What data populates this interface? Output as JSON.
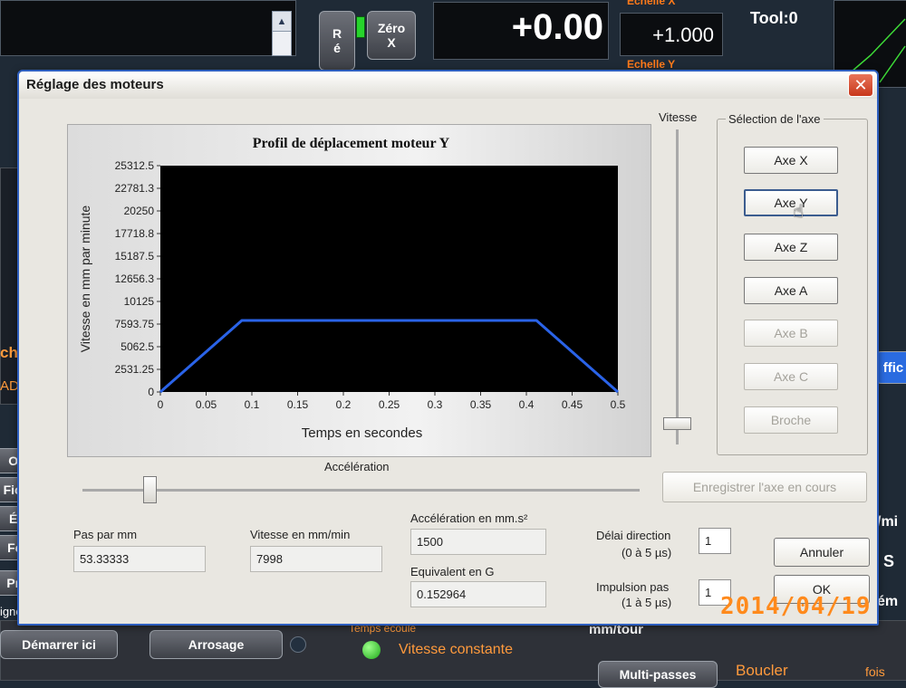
{
  "background": {
    "dro_value": "+0.00",
    "scale_x_label": "Echelle X",
    "scale_value": "+1.000",
    "scale_y_label": "Echelle Y",
    "tool_label": "Tool:0",
    "zero_label_1": "Zéro",
    "zero_label_2": "X",
    "ref_label_1": "R",
    "ref_label_2": "é",
    "left_button_labels": [
      "Ou",
      "Fich",
      "Éd",
      "Fer",
      "Pro"
    ],
    "left_labels": [
      "ch",
      "ADc",
      "igne"
    ],
    "start_here_button": "Démarrer ici",
    "coolant_button": "Arrosage",
    "constant_speed_label": "Vitesse constante",
    "elapsed_time_label": "Temps écoulé",
    "mm_per_rev_label": "mm/tour",
    "multipass_button": "Multi-passes",
    "loop_label": "Boucler",
    "times_label": "fois",
    "right_labels": [
      "ffic",
      "/mi",
      "S",
      "ém"
    ]
  },
  "dialog": {
    "title": "Réglage des moteurs",
    "close_icon": "close-icon",
    "speed_slider_label": "Vitesse",
    "speed_slider_value": 0.0,
    "acceleration_slider_label": "Accélération",
    "acceleration_slider_value": 0.12,
    "axis_group_label": "Sélection de l'axe",
    "axis_buttons": [
      {
        "label": "Axe X",
        "enabled": true
      },
      {
        "label": "Axe Y",
        "enabled": true,
        "focused": true
      },
      {
        "label": "Axe Z",
        "enabled": true
      },
      {
        "label": "Axe A",
        "enabled": true
      },
      {
        "label": "Axe B",
        "enabled": false
      },
      {
        "label": "Axe C",
        "enabled": false
      },
      {
        "label": "Broche",
        "enabled": false
      }
    ],
    "save_axis_button": "Enregistrer l'axe en cours",
    "steps_per_mm_label": "Pas par mm",
    "steps_per_mm_value": "53.33333",
    "velocity_label": "Vitesse en mm/min",
    "velocity_value": "7998",
    "accel_label": "Accélération en mm.s²",
    "accel_value": "1500",
    "g_equiv_label": "Equivalent en G",
    "g_equiv_value": "0.152964",
    "dir_delay_label": "Délai direction",
    "dir_delay_range": "(0 à 5 µs)",
    "dir_delay_value": "1",
    "step_pulse_label": "Impulsion pas",
    "step_pulse_range": "(1 à 5 µs)",
    "step_pulse_value": "1",
    "cancel_button": "Annuler",
    "ok_button": "OK"
  },
  "photo_timestamp": "2014/04/19",
  "chart_data": {
    "type": "line",
    "title": "Profil de déplacement moteur Y",
    "xlabel": "Temps en secondes",
    "ylabel": "Vitesse en mm par minute",
    "xlim": [
      0,
      0.5
    ],
    "ylim": [
      0,
      25312.5
    ],
    "x_ticks": [
      "0",
      "0.05",
      "0.1",
      "0.15",
      "0.2",
      "0.25",
      "0.3",
      "0.35",
      "0.4",
      "0.45",
      "0.5"
    ],
    "y_ticks": [
      "0",
      "2531.25",
      "5062.5",
      "7593.75",
      "10125",
      "12656.3",
      "15187.5",
      "17718.8",
      "20250",
      "22781.3",
      "25312.5"
    ],
    "series": [
      {
        "x": [
          0,
          0.089,
          0.411,
          0.5
        ],
        "y": [
          0,
          7998,
          7998,
          0
        ],
        "color": "#2a63e8"
      }
    ],
    "plot_background": "#000000",
    "grid": false
  }
}
